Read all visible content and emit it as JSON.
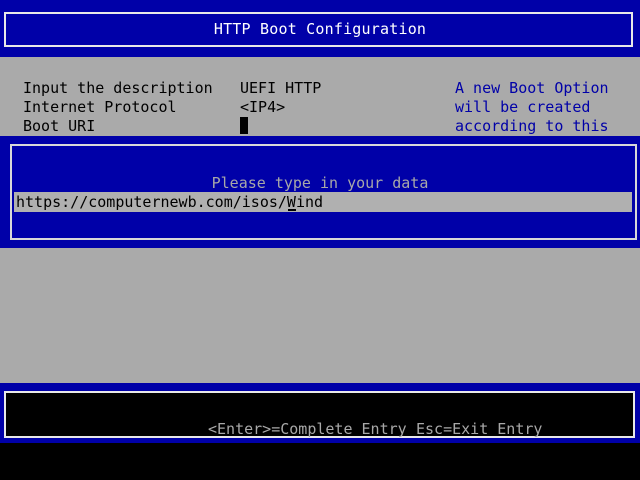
{
  "header": {
    "title": "HTTP Boot Configuration"
  },
  "form": {
    "fields": [
      {
        "label": "Input the description",
        "value": "UEFI HTTP"
      },
      {
        "label": "Internet Protocol",
        "value": "<IP4>"
      },
      {
        "label": "Boot URI",
        "value": ""
      }
    ],
    "help_lines": [
      "A new Boot Option",
      "will be created",
      "according to this"
    ]
  },
  "dialog": {
    "prompt": "Please type in your data",
    "input_value": "https://computernewb.com/isos/Wind"
  },
  "footer": {
    "enter_hint": "<Enter>=Complete Entry",
    "esc_hint": "Esc=Exit Entry"
  },
  "colors": {
    "background": "#000000",
    "panel_blue": "#0000a8",
    "form_gray": "#aaaaaa",
    "help_text_blue": "#0000a8",
    "title_white": "#ffffff",
    "dim_text": "#a8a8a8"
  }
}
